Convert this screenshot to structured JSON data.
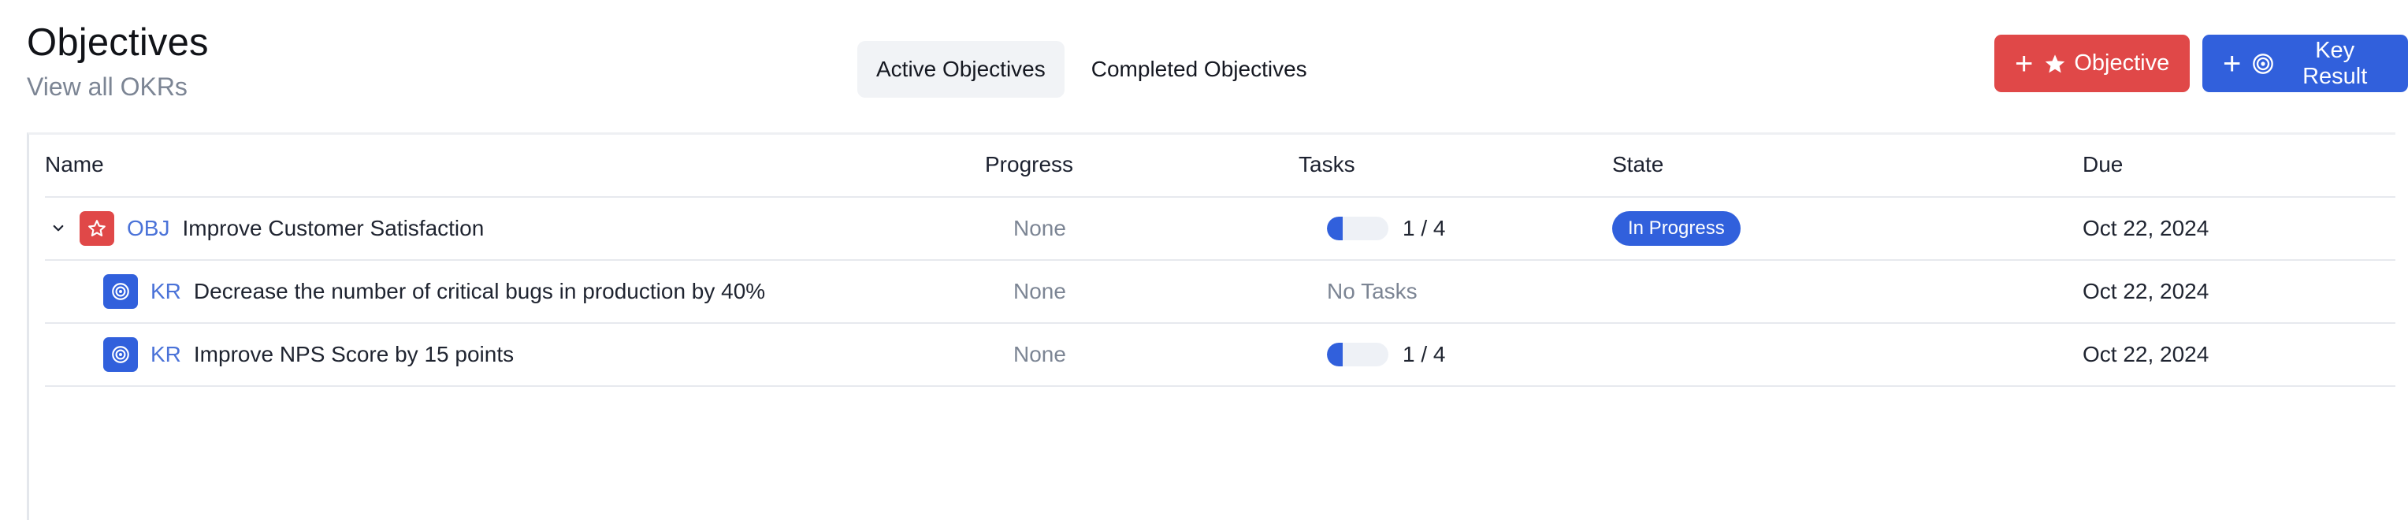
{
  "header": {
    "title": "Objectives",
    "subtitle": "View all OKRs"
  },
  "tabs": [
    {
      "label": "Active Objectives",
      "active": true
    },
    {
      "label": "Completed Objectives",
      "active": false
    }
  ],
  "actions": {
    "objective_label": "Objective",
    "key_result_label": "Key Result",
    "objective_color": "#e04848",
    "key_result_color": "#3160dc"
  },
  "table": {
    "columns": {
      "name": "Name",
      "progress": "Progress",
      "tasks": "Tasks",
      "state": "State",
      "due": "Due"
    },
    "rows": [
      {
        "type": "OBJ",
        "icon": "star-icon",
        "name": "Improve Customer Satisfaction",
        "progress": "None",
        "tasks_text": "1 / 4",
        "tasks_fraction": 0.25,
        "state": "In Progress",
        "due": "Oct 22, 2024"
      },
      {
        "type": "KR",
        "icon": "target-icon",
        "name": "Decrease the number of critical bugs in production by 40%",
        "progress": "None",
        "tasks_text": "No Tasks",
        "state": "",
        "due": "Oct 22, 2024"
      },
      {
        "type": "KR",
        "icon": "target-icon",
        "name": "Improve NPS Score by 15 points",
        "progress": "None",
        "tasks_text": "1 / 4",
        "tasks_fraction": 0.25,
        "state": "",
        "due": "Oct 22, 2024"
      }
    ]
  }
}
